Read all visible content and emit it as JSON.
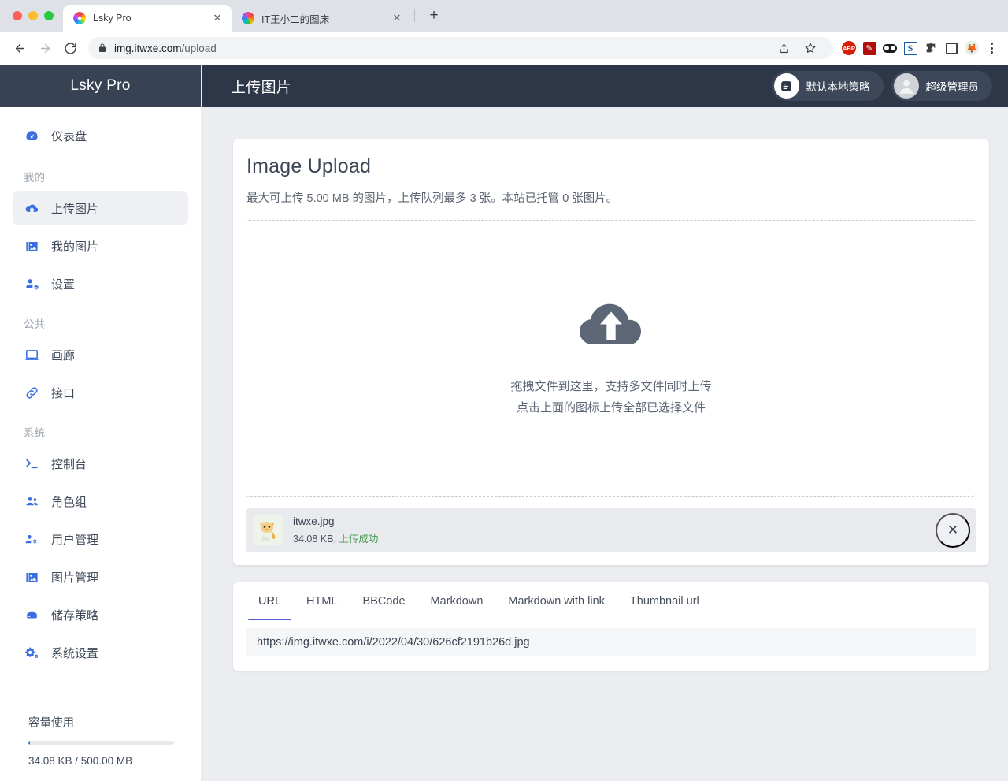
{
  "browser": {
    "tabs": [
      {
        "title": "Lsky Pro",
        "favicon": "lsky-pinwheel-icon",
        "active": true
      },
      {
        "title": "IT王小二的图床",
        "favicon": "lsky-pinwheel-icon",
        "active": false
      }
    ],
    "new_tab_label": "+",
    "close_label": "✕",
    "url_host": "img.itwxe.com",
    "url_path": "/upload",
    "nav": {
      "back": "back-arrow",
      "forward": "forward-arrow",
      "reload": "reload-icon"
    },
    "omnibox_actions": [
      "share-icon",
      "bookmark-star-icon"
    ],
    "extensions": [
      "adblock-plus-icon",
      "markdown-wand-icon",
      "dark-reader-icon",
      "sogou-s-icon",
      "puzzle-piece-icon",
      "side-panel-icon",
      "profile-avatar-icon"
    ],
    "menu": "kebab-menu-icon"
  },
  "sidebar": {
    "brand": "Lsky Pro",
    "items": [
      {
        "label": "仪表盘",
        "icon": "dashboard-gauge-icon",
        "active": false,
        "group": null
      },
      {
        "label": "上传图片",
        "icon": "cloud-upload-icon",
        "active": true,
        "group": "我的"
      },
      {
        "label": "我的图片",
        "icon": "image-stack-icon",
        "active": false,
        "group": null
      },
      {
        "label": "设置",
        "icon": "user-cog-icon",
        "active": false,
        "group": null
      },
      {
        "label": "画廊",
        "icon": "gallery-monitor-icon",
        "active": false,
        "group": "公共"
      },
      {
        "label": "接口",
        "icon": "link-chain-icon",
        "active": false,
        "group": null
      },
      {
        "label": "控制台",
        "icon": "terminal-prompt-icon",
        "active": false,
        "group": "系统"
      },
      {
        "label": "角色组",
        "icon": "users-group-icon",
        "active": false,
        "group": null
      },
      {
        "label": "用户管理",
        "icon": "user-manage-icon",
        "active": false,
        "group": null
      },
      {
        "label": "图片管理",
        "icon": "image-stack-icon",
        "active": false,
        "group": null
      },
      {
        "label": "储存策略",
        "icon": "database-drive-icon",
        "active": false,
        "group": null
      },
      {
        "label": "系统设置",
        "icon": "gears-icon",
        "active": false,
        "group": null
      }
    ],
    "groups": {
      "mine": "我的",
      "public": "公共",
      "system": "系统"
    },
    "capacity": {
      "title": "容量使用",
      "used_text": "34.08 KB / 500.00 MB",
      "percent": 0.0066,
      "bar_color": "#3b6fe0"
    }
  },
  "topbar": {
    "title": "上传图片",
    "strategy_label": "默认本地策略",
    "strategy_icon": "server-list-icon",
    "user_label": "超级管理员",
    "user_icon": "user-avatar-icon"
  },
  "upload": {
    "card_title": "Image Upload",
    "card_subtitle": "最大可上传 5.00 MB 的图片，上传队列最多 3 张。本站已托管 0 张图片。",
    "dropzone": {
      "icon": "cloud-upload-icon",
      "line1": "拖拽文件到这里，支持多文件同时上传",
      "line2": "点击上面的图标上传全部已选择文件"
    },
    "files": [
      {
        "name": "itwxe.jpg",
        "size": "34.08 KB",
        "separator": ", ",
        "status": "上传成功",
        "status_color": "#4a9b52",
        "thumbnail": "fox-avatar-thumbnail",
        "remove_label": "✕"
      }
    ]
  },
  "result": {
    "tabs": [
      {
        "label": "URL",
        "active": true
      },
      {
        "label": "HTML",
        "active": false
      },
      {
        "label": "BBCode",
        "active": false
      },
      {
        "label": "Markdown",
        "active": false
      },
      {
        "label": "Markdown with link",
        "active": false
      },
      {
        "label": "Thumbnail url",
        "active": false
      }
    ],
    "value": "https://img.itwxe.com/i/2022/04/30/626cf2191b26d.jpg",
    "active_underline_color": "#4e5bdb"
  }
}
